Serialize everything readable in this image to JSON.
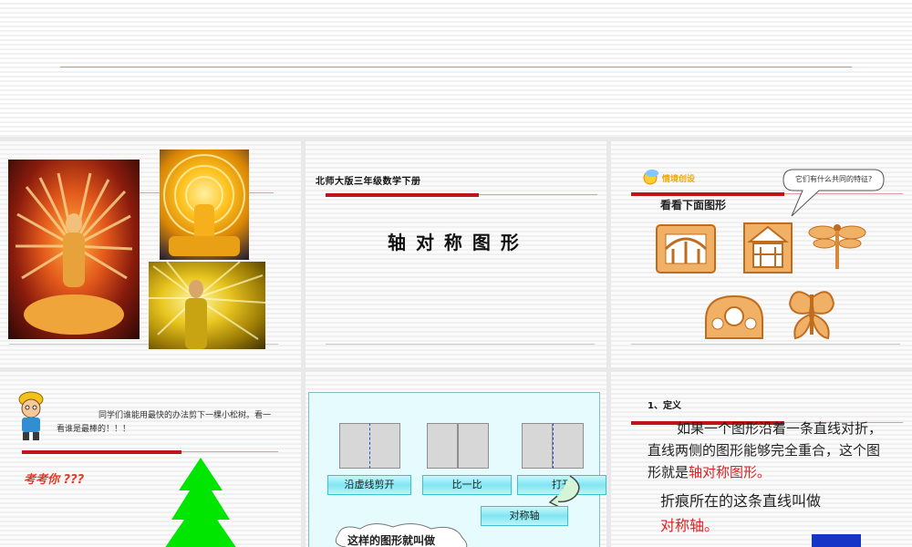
{
  "slide2": {
    "header": "北师大版三年级数学下册",
    "title": "轴 对 称 图 形"
  },
  "slide3": {
    "badge": "情境创设",
    "bubble": "它们有什么共同的特征?",
    "heading": "看看下面图形"
  },
  "slide4": {
    "prompt": "同学们谁能用最快的办法剪下一棵小松树。看一看谁是最棒的！！！",
    "test_label": "考考你 ???",
    "tree_color": "#00e600"
  },
  "slide5": {
    "step_labels": [
      "沿虚线剪开",
      "比一比",
      "打开"
    ],
    "axis_label": "对称轴",
    "cloud_text": "这样的图形就叫做"
  },
  "slide6": {
    "section": "1、定义",
    "def_pre": "如果一个图形沿着一条直线对折，直线两侧的图形能够完全重合，这个图形就是",
    "def_term": "轴对称图形。",
    "crease_pre": "折痕所在的这条直线叫做",
    "crease_term": "对称轴。"
  },
  "colors": {
    "accent_red": "#c0141c",
    "term_red": "#e02020",
    "button_cyan": "#7fe6f2"
  }
}
